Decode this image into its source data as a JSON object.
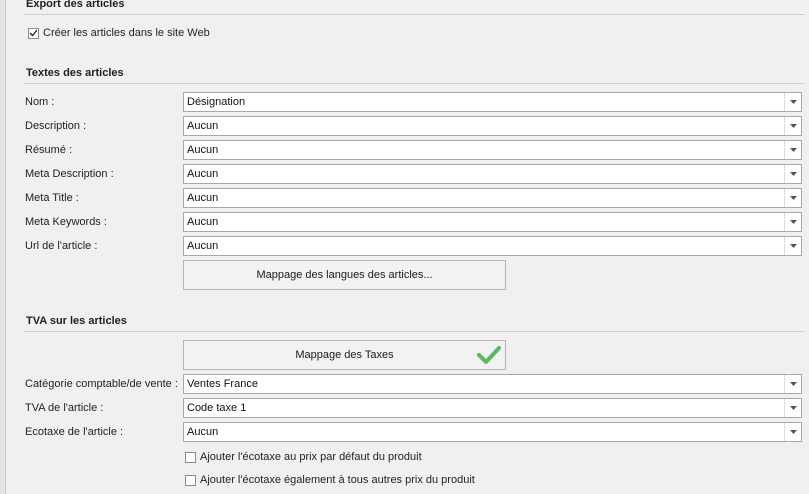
{
  "sections": {
    "export": {
      "title": "Export des articles"
    },
    "textes": {
      "title": "Textes des articles"
    },
    "tva": {
      "title": "TVA sur les articles"
    }
  },
  "export": {
    "create_articles": {
      "label": "Créer les articles dans le site Web",
      "checked": true
    }
  },
  "textes": {
    "fields": [
      {
        "label": "Nom :",
        "value": "Désignation"
      },
      {
        "label": "Description :",
        "value": "Aucun"
      },
      {
        "label": "Résumé :",
        "value": "Aucun"
      },
      {
        "label": "Meta Description :",
        "value": "Aucun"
      },
      {
        "label": "Meta Title :",
        "value": "Aucun"
      },
      {
        "label": "Meta Keywords :",
        "value": "Aucun"
      },
      {
        "label": "Url de l'article :",
        "value": "Aucun"
      }
    ],
    "mapping_button": "Mappage des langues des articles..."
  },
  "tva": {
    "mapping_button": "Mappage des Taxes",
    "mapping_status_icon": "green-check-icon",
    "fields": [
      {
        "label": "Catégorie comptable/de vente :",
        "value": "Ventes France"
      },
      {
        "label": "TVA de l'article :",
        "value": "Code taxe 1"
      },
      {
        "label": "Ecotaxe de l'article :",
        "value": "Aucun"
      }
    ],
    "options": [
      {
        "label": "Ajouter l'écotaxe au prix par défaut du produit",
        "checked": false
      },
      {
        "label": "Ajouter l'écotaxe également à tous autres prix du produit",
        "checked": false
      }
    ]
  },
  "colors": {
    "check_green": "#5cb85c",
    "border": "#a8a8a8",
    "background": "#f0f0f0"
  }
}
